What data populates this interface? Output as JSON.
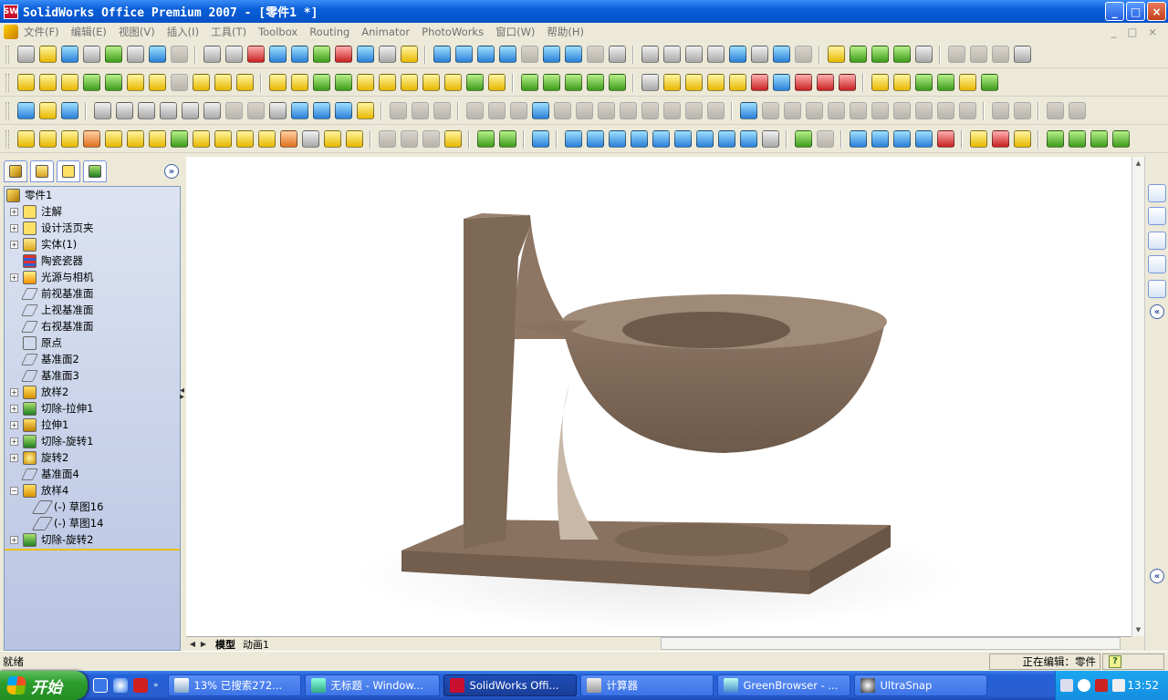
{
  "window": {
    "title": "SolidWorks Office Premium 2007 - [零件1 *]",
    "app_icon_label": "SW",
    "minimize_label": "_",
    "maximize_label": "□",
    "close_label": "×"
  },
  "menu": {
    "items": [
      "文件(F)",
      "编辑(E)",
      "视图(V)",
      "插入(I)",
      "工具(T)",
      "Toolbox",
      "Routing",
      "Animator",
      "PhotoWorks",
      "窗口(W)",
      "帮助(H)"
    ],
    "mdi_controls": [
      "_",
      "□",
      "×"
    ]
  },
  "feature_manager": {
    "expand_label": "»",
    "tree": [
      {
        "label": "零件1",
        "icon": "part-icon",
        "expand": "",
        "indent": 0
      },
      {
        "label": "注解",
        "icon": "annotation-icon",
        "expand": "+",
        "indent": 1
      },
      {
        "label": "设计活页夹",
        "icon": "design-binder-icon",
        "expand": "+",
        "indent": 1
      },
      {
        "label": "实体(1)",
        "icon": "solid-bodies-icon",
        "expand": "+",
        "indent": 1
      },
      {
        "label": "陶瓷瓷器",
        "icon": "material-icon",
        "expand": "",
        "indent": 1
      },
      {
        "label": "光源与相机",
        "icon": "lights-cameras-icon",
        "expand": "+",
        "indent": 1
      },
      {
        "label": "前视基准面",
        "icon": "plane-icon",
        "expand": "",
        "indent": 1
      },
      {
        "label": "上视基准面",
        "icon": "plane-icon",
        "expand": "",
        "indent": 1
      },
      {
        "label": "右视基准面",
        "icon": "plane-icon",
        "expand": "",
        "indent": 1
      },
      {
        "label": "原点",
        "icon": "origin-icon",
        "expand": "",
        "indent": 1
      },
      {
        "label": "基准面2",
        "icon": "plane-icon",
        "expand": "",
        "indent": 1
      },
      {
        "label": "基准面3",
        "icon": "plane-icon",
        "expand": "",
        "indent": 1
      },
      {
        "label": "放样2",
        "icon": "loft-icon",
        "expand": "+",
        "indent": 1
      },
      {
        "label": "切除-拉伸1",
        "icon": "cut-extrude-icon",
        "expand": "+",
        "indent": 1
      },
      {
        "label": "拉伸1",
        "icon": "extrude-icon",
        "expand": "+",
        "indent": 1
      },
      {
        "label": "切除-旋转1",
        "icon": "cut-revolve-icon",
        "expand": "+",
        "indent": 1
      },
      {
        "label": "旋转2",
        "icon": "revolve-icon",
        "expand": "+",
        "indent": 1
      },
      {
        "label": "基准面4",
        "icon": "plane-icon",
        "expand": "",
        "indent": 1
      },
      {
        "label": "放样4",
        "icon": "loft-icon",
        "expand": "−",
        "indent": 1
      },
      {
        "label": "(-) 草图16",
        "icon": "sketch-icon",
        "expand": "",
        "indent": 2
      },
      {
        "label": "(-) 草图14",
        "icon": "sketch-icon",
        "expand": "",
        "indent": 2
      },
      {
        "label": "切除-旋转2",
        "icon": "cut-revolve-icon",
        "expand": "+",
        "indent": 1
      }
    ]
  },
  "view_tabs": {
    "tabs": [
      "模型",
      "动画1"
    ],
    "active": "模型"
  },
  "status": {
    "left": "就绪",
    "right": "正在编辑：零件",
    "help_icon": "?"
  },
  "taskbar": {
    "start_label": "开始",
    "quicklaunch_more": "»",
    "tasks": [
      {
        "label": "13%  已搜索272...",
        "icon": "download-icon",
        "active": false
      },
      {
        "label": "无标题 - Window...",
        "icon": "paint-icon",
        "active": false
      },
      {
        "label": "SolidWorks Offi...",
        "icon": "solidworks-icon",
        "active": true
      },
      {
        "label": "计算器",
        "icon": "calculator-icon",
        "active": false
      },
      {
        "label": "GreenBrowser - ...",
        "icon": "browser-icon",
        "active": false
      },
      {
        "label": "UltraSnap",
        "icon": "ultrasnap-icon",
        "active": false
      }
    ],
    "clock": "13:52"
  },
  "colors": {
    "titlebar": "#0a5fd8",
    "tree_background": "#c8d2ea",
    "tree_separator": "#e8c000",
    "model_stone": "#8a7260",
    "taskbar": "#2a5fd0",
    "start_button": "#2d9d2d"
  }
}
